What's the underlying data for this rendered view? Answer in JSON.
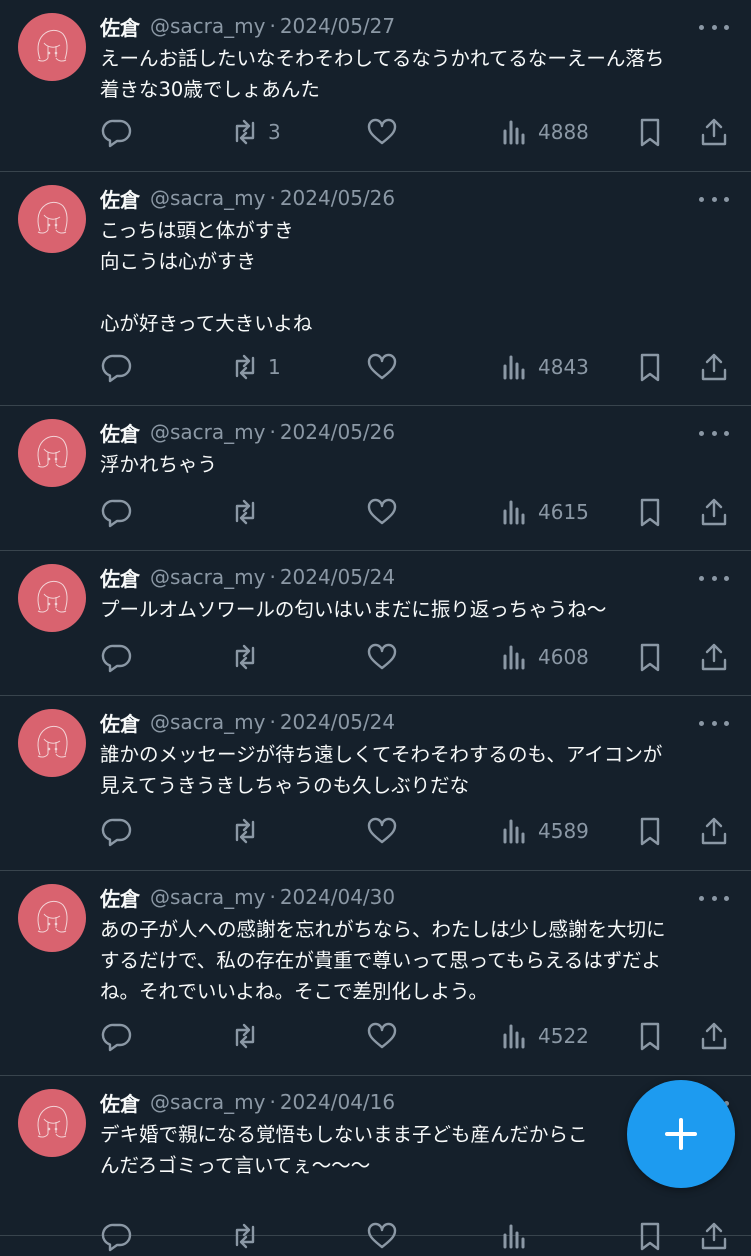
{
  "tweets": [
    {
      "name": "佐倉",
      "handle": "@sacra_my",
      "date": "2024/05/27",
      "text": "えーんお話したいなそわそわしてるなうかれてるなーえーん落ち\n着きな30歳でしょあんた",
      "retweets": "3",
      "views": "4888"
    },
    {
      "name": "佐倉",
      "handle": "@sacra_my",
      "date": "2024/05/26",
      "text": "こっちは頭と体がすき\n向こうは心がすき\n\n心が好きって大きいよね",
      "retweets": "1",
      "views": "4843"
    },
    {
      "name": "佐倉",
      "handle": "@sacra_my",
      "date": "2024/05/26",
      "text": "浮かれちゃう",
      "retweets": "",
      "views": "4615"
    },
    {
      "name": "佐倉",
      "handle": "@sacra_my",
      "date": "2024/05/24",
      "text": "プールオムソワールの匂いはいまだに振り返っちゃうね〜",
      "retweets": "",
      "views": "4608"
    },
    {
      "name": "佐倉",
      "handle": "@sacra_my",
      "date": "2024/05/24",
      "text": "誰かのメッセージが待ち遠しくてそわそわするのも、アイコンが\n見えてうきうきしちゃうのも久しぶりだな",
      "retweets": "",
      "views": "4589"
    },
    {
      "name": "佐倉",
      "handle": "@sacra_my",
      "date": "2024/04/30",
      "text": "あの子が人への感謝を忘れがちなら、わたしは少し感謝を大切に\nするだけで、私の存在が貴重で尊いって思ってもらえるはずだよ\nね。それでいいよね。そこで差別化しよう。",
      "retweets": "",
      "views": "4522"
    },
    {
      "name": "佐倉",
      "handle": "@sacra_my",
      "date": "2024/04/16",
      "text": "デキ婚で親になる覚悟もしないまま子ども産んだからこ\nんだろゴミって言いてぇ〜〜〜",
      "retweets": "",
      "views": ""
    }
  ],
  "icons": {
    "reply": "reply-icon",
    "retweet": "retweet-icon",
    "like": "heart-icon",
    "views": "views-icon",
    "bookmark": "bookmark-icon",
    "share": "share-icon",
    "more": "more-icon",
    "compose": "plus-icon"
  },
  "colors": {
    "background": "#15202b",
    "muted": "#8b98a5",
    "accent": "#1d9bf0",
    "avatar": "#d9636f"
  }
}
